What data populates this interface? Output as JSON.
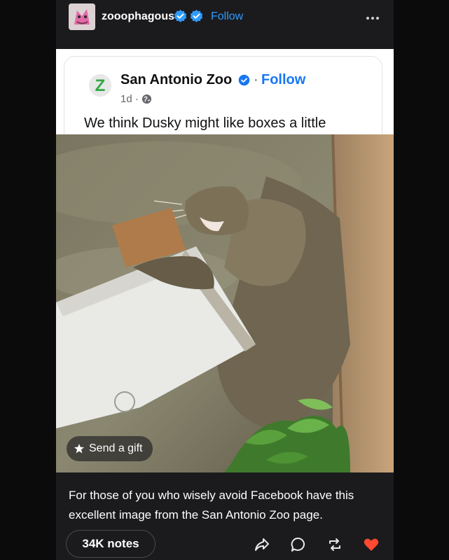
{
  "header": {
    "blog_name": "zooophagous",
    "follow_label": "Follow"
  },
  "embed": {
    "page_name": "San Antonio Zoo",
    "follow_label": "Follow",
    "separator": "·",
    "time_ago": "1d ·",
    "caption": "We think Dusky might like boxes a little",
    "logo_letter": "Z",
    "gift_label": "Send a gift"
  },
  "body": {
    "text": "For those of you who wisely avoid Facebook have this excellent image from the San Antonio Zoo page."
  },
  "footer": {
    "notes_label": "34K notes"
  },
  "colors": {
    "accent_blue": "#2f9bff",
    "facebook_blue": "#1877f2",
    "like_red": "#ff4930",
    "card_bg": "#1b1b1d"
  },
  "icons": [
    "verified-icon",
    "more-icon",
    "globe-icon",
    "gift-icon",
    "share-icon",
    "reply-icon",
    "reblog-icon",
    "heart-icon"
  ]
}
